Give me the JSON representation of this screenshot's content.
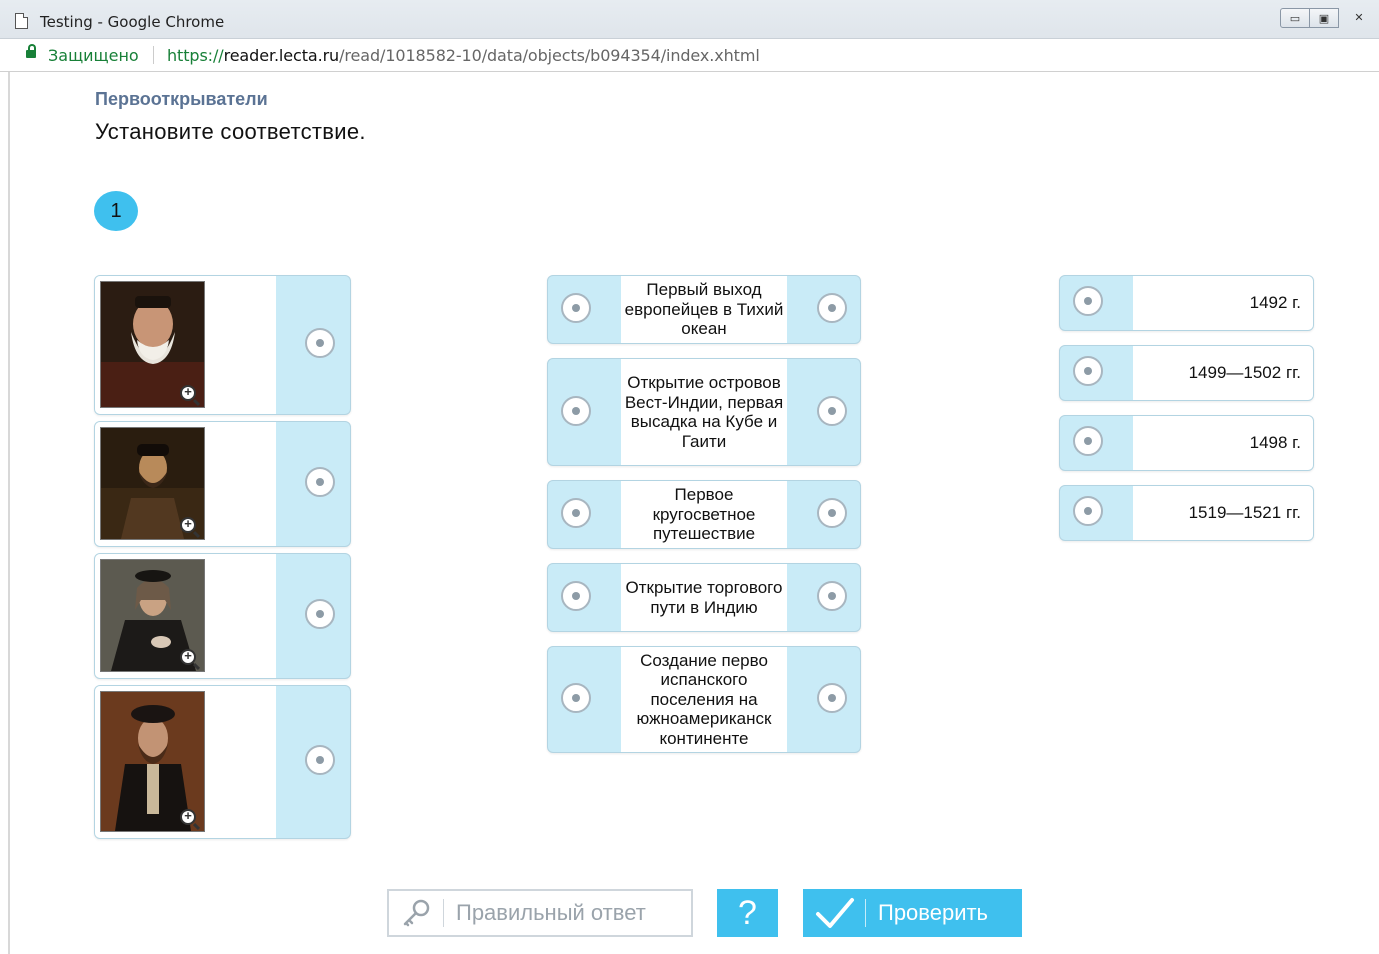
{
  "window": {
    "title": "Testing - Google Chrome",
    "secure_label": "Защищено",
    "url_scheme": "https://",
    "url_host": "reader.lecta.ru",
    "url_path": "/read/1018582-10/data/objects/b094354/index.xhtml",
    "minimize_label": "▭",
    "maximize_label": "▣",
    "close_label": "✕"
  },
  "content": {
    "subtitle": "Первооткрыватели",
    "instruction": "Установите соответствие.",
    "task_number": "1"
  },
  "events": [
    "Первый выход европейцев в Тихий океан",
    "Открытие островов Вест-Индии, первая высадка на Кубе и Гаити",
    "Первое кругосветное путешествие",
    "Открытие торгового пути в Индию",
    "Создание перво испанского поселения на южноамериканск континенте"
  ],
  "years": [
    "1492 г.",
    "1499—1502 гг.",
    "1498 г.",
    "1519—1521 гг."
  ],
  "buttons": {
    "answer_label": "Правильный ответ",
    "help_label": "?",
    "check_label": "Проверить"
  },
  "colors": {
    "accent": "#3fc0ee",
    "card_blue": "#c9ebf7",
    "subtitle": "#5b7394",
    "secure_green": "#188038"
  }
}
